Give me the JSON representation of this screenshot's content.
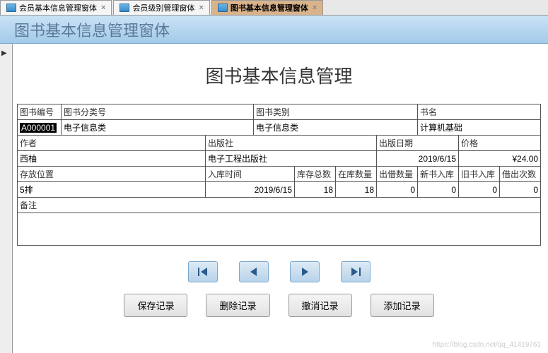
{
  "tabs": [
    {
      "label": "会员基本信息管理窗体",
      "active": false
    },
    {
      "label": "会员级别管理窗体",
      "active": false
    },
    {
      "label": "图书基本信息管理窗体",
      "active": true
    }
  ],
  "header": {
    "title": "图书基本信息管理窗体"
  },
  "main_title": "图书基本信息管理",
  "labels": {
    "book_id": "图书编号",
    "category_no": "图书分类号",
    "category": "图书类别",
    "book_name": "书名",
    "author": "作者",
    "publisher": "出版社",
    "pub_date": "出版日期",
    "price": "价格",
    "location": "存放位置",
    "in_time": "入库时间",
    "total_stock": "库存总数",
    "in_stock": "在库数量",
    "lent_qty": "出借数量",
    "new_in": "新书入库",
    "old_in": "旧书入库",
    "lend_times": "借出次数",
    "memo": "备注"
  },
  "values": {
    "book_id": "A000001",
    "category_no": "电子信息类",
    "category": "电子信息类",
    "book_name": "计算机基础",
    "author": "西柚",
    "publisher": "电子工程出版社",
    "pub_date": "2019/6/15",
    "price": "¥24.00",
    "location": "5排",
    "in_time": "2019/6/15",
    "total_stock": "18",
    "in_stock": "18",
    "lent_qty": "0",
    "new_in": "0",
    "old_in": "0",
    "lend_times": "0",
    "memo": ""
  },
  "nav": {
    "first": "first",
    "prev": "prev",
    "next": "next",
    "last": "last"
  },
  "actions": {
    "save": "保存记录",
    "delete": "删除记录",
    "cancel": "撤消记录",
    "add": "添加记录"
  },
  "watermark": "https://blog.csdn.net/qq_41419761"
}
